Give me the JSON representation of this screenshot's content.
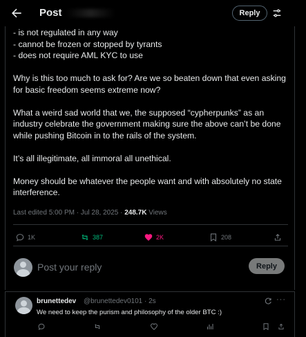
{
  "header": {
    "title": "Post",
    "reply_label": "Reply"
  },
  "post": {
    "lines": [
      "- is not regulated in any way",
      "- cannot be frozen or stopped by tyrants",
      "- does not require AML KYC to use"
    ],
    "paragraphs": [
      "Why is this too much to ask for?  Are we so beaten down that even asking for basic freedom seems extreme now?",
      "What a weird sad world that we, the supposed “cypherpunks” as an industry celebrate the government making sure the above can’t be done while pushing Bitcoin in to the rails of the system.",
      "It’s all illegitimate, all immoral all unethical.",
      "Money should be whatever the people want and with absolutely no state interference."
    ],
    "meta": {
      "edited": "Last edited 5:00 PM · Jul 28, 2025 · ",
      "views_count": "248.7K",
      "views_label": " Views"
    },
    "stats": {
      "replies": "1K",
      "reposts": "387",
      "likes": "2K",
      "bookmarks": "208"
    }
  },
  "composer": {
    "placeholder": "Post your reply",
    "button": "Reply"
  },
  "reply": {
    "name": "brunettedev",
    "handle": "@brunettedev0101 · 2s",
    "text": "We need to keep the purism and philosophy of the older BTC :)",
    "more": "···"
  },
  "colors": {
    "background": "#000000",
    "text": "#e7e9ea",
    "muted": "#71767b",
    "border": "#2f3336",
    "repost_green": "#00ba7c",
    "like_pink": "#f91880",
    "reply_button_disabled": "#787a7a"
  },
  "icons": {
    "back": "arrow-left-icon",
    "tune": "sliders-icon",
    "reply": "speech-bubble-icon",
    "repost": "repost-arrows-icon",
    "like": "heart-filled-icon",
    "bookmark": "bookmark-icon",
    "share": "share-upload-icon",
    "grok": "grok-icon",
    "views": "bar-chart-icon"
  }
}
